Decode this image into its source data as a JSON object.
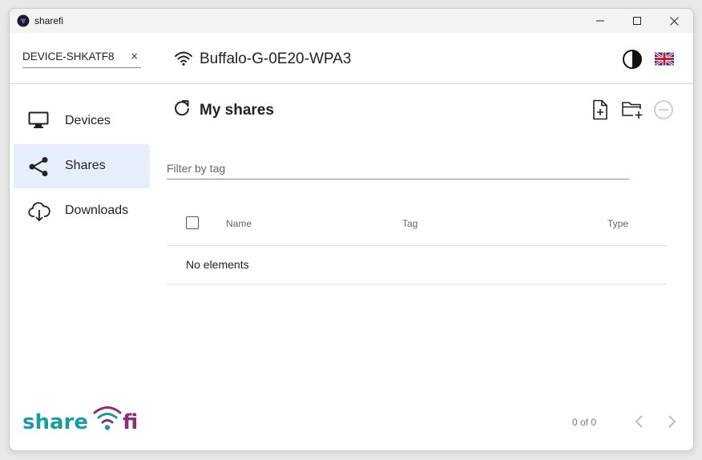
{
  "window": {
    "title": "sharefi"
  },
  "header": {
    "pc_name": "DEVICE-SHKATF8",
    "clear_symbol": "×",
    "network_name": "Buffalo-G-0E20-WPA3",
    "language": "en-GB"
  },
  "sidebar": {
    "items": [
      {
        "label": "Devices",
        "icon": "monitor-icon",
        "active": false
      },
      {
        "label": "Shares",
        "icon": "share-icon",
        "active": true
      },
      {
        "label": "Downloads",
        "icon": "cloud-download-icon",
        "active": false
      }
    ]
  },
  "main": {
    "title": "My shares",
    "filter_placeholder": "Filter by tag",
    "filter_value": "",
    "table": {
      "columns": [
        "Name",
        "Tag",
        "Type"
      ],
      "rows": [],
      "empty_text": "No elements"
    },
    "pagination": {
      "text": "0 of 0"
    }
  },
  "logo": {
    "text_left": "share",
    "text_right": "fi"
  },
  "colors": {
    "accent_active_bg": "#e6eefb",
    "logo_teal": "#1a9ba0",
    "logo_purple": "#8b2f7c"
  }
}
